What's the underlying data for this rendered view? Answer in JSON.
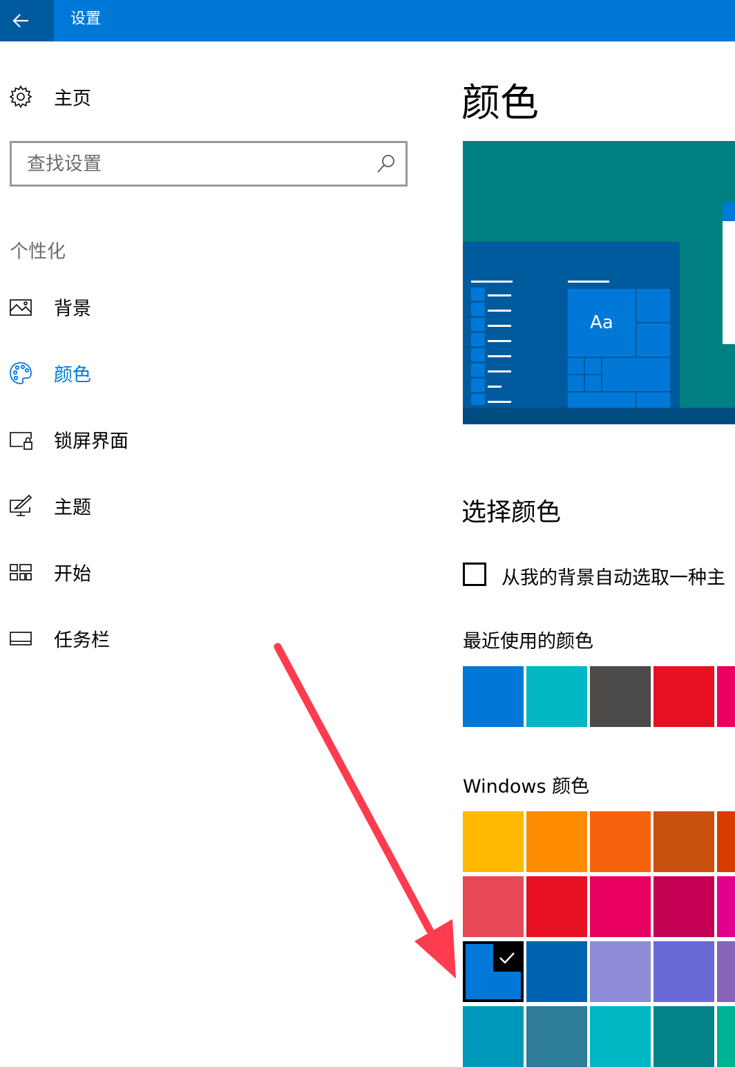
{
  "titlebar": {
    "title": "设置",
    "back_icon": "back-arrow-icon"
  },
  "sidebar": {
    "home": {
      "label": "主页",
      "icon": "gear-icon"
    },
    "search": {
      "placeholder": "查找设置",
      "icon": "search-icon"
    },
    "section_header": "个性化",
    "items": [
      {
        "label": "背景",
        "icon": "picture-icon",
        "active": false
      },
      {
        "label": "颜色",
        "icon": "palette-icon",
        "active": true
      },
      {
        "label": "锁屏界面",
        "icon": "lock-screen-icon",
        "active": false
      },
      {
        "label": "主题",
        "icon": "theme-icon",
        "active": false
      },
      {
        "label": "开始",
        "icon": "start-icon",
        "active": false
      },
      {
        "label": "任务栏",
        "icon": "taskbar-icon",
        "active": false
      }
    ]
  },
  "main": {
    "title": "颜色",
    "preview": {
      "tile_text": "Aa"
    },
    "choose_color": {
      "title": "选择颜色",
      "auto_pick_label": "从我的背景自动选取一种主",
      "auto_pick_checked": false
    },
    "recent_colors": {
      "label": "最近使用的颜色",
      "swatches": [
        "#0078d7",
        "#00b7c3",
        "#4c4a48",
        "#e81123",
        "#ea005e"
      ]
    },
    "windows_colors": {
      "label": "Windows 颜色",
      "rows": [
        [
          "#ffb900",
          "#ff8c00",
          "#f7630c",
          "#ca5010",
          "#da3b01"
        ],
        [
          "#e74856",
          "#e81123",
          "#ea005e",
          "#c30052",
          "#e3008c"
        ],
        [
          "#0078d7",
          "#0063b1",
          "#8e8cd8",
          "#6b69d6",
          "#8764b8"
        ],
        [
          "#0099bc",
          "#2d7d9a",
          "#00b7c3",
          "#038387",
          "#00b294"
        ]
      ],
      "selected": "#0078d7"
    }
  },
  "colors": {
    "accent": "#0078d7",
    "titlebar": "#0078d7",
    "back_button": "#005a9e",
    "annotation_arrow": "#ff3b4e"
  }
}
